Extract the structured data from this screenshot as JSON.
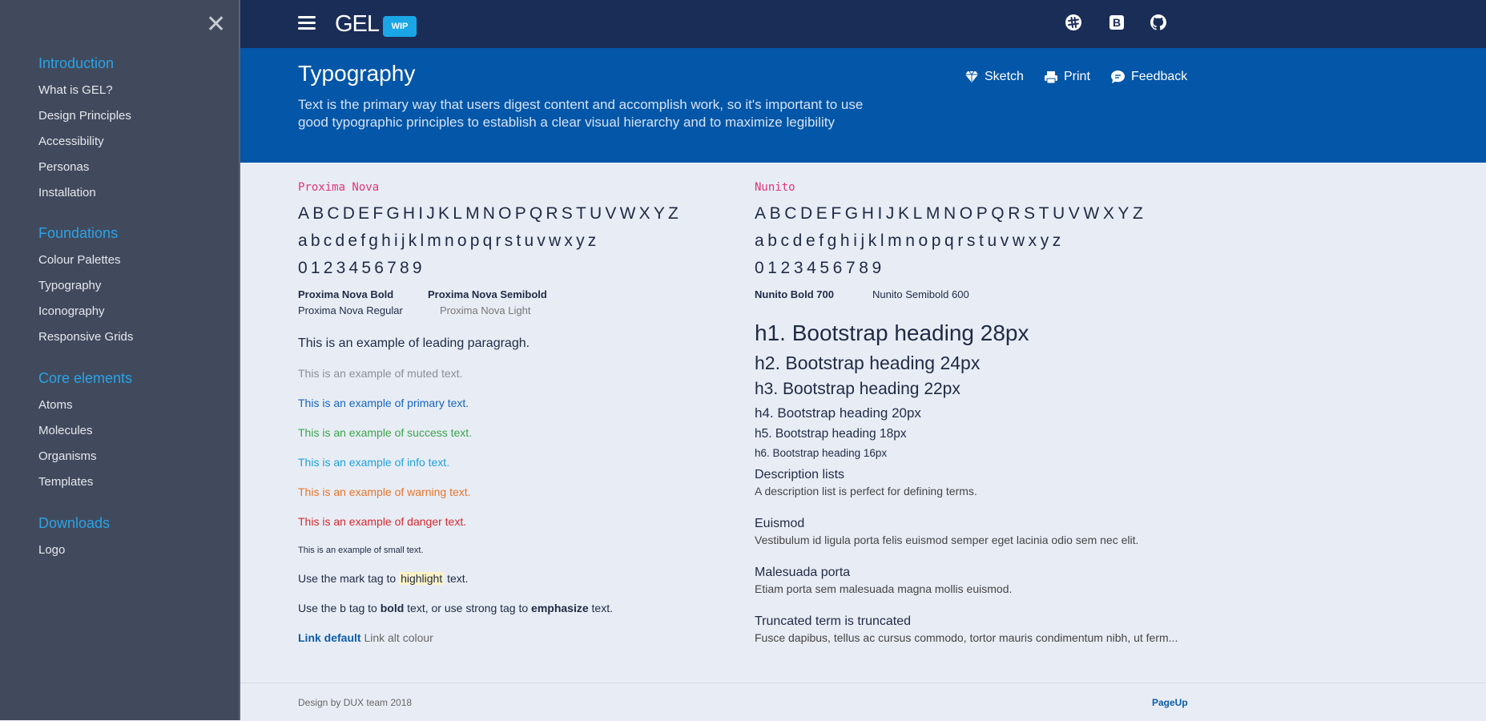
{
  "sidebar": {
    "close_glyph": "✕",
    "sections": [
      {
        "title": "Introduction",
        "items": [
          "What is GEL?",
          "Design Principles",
          "Accessibility",
          "Personas",
          "Installation"
        ]
      },
      {
        "title": "Foundations",
        "items": [
          "Colour Palettes",
          "Typography",
          "Iconography",
          "Responsive Grids"
        ]
      },
      {
        "title": "Core elements",
        "items": [
          "Atoms",
          "Molecules",
          "Organisms",
          "Templates"
        ]
      },
      {
        "title": "Downloads",
        "items": [
          "Logo"
        ]
      }
    ]
  },
  "topbar": {
    "logo": "GEL",
    "badge": "WIP",
    "icons": [
      "slack-icon",
      "bootstrap-icon",
      "github-icon"
    ],
    "bootstrap_letter": "B"
  },
  "header": {
    "title": "Typography",
    "lead": "Text is the primary way that users digest content and accomplish work, so it's important to use good typographic principles to establish a clear visual hierarchy and to maximize legibility",
    "actions": [
      {
        "label": "Sketch",
        "icon": "diamond-icon"
      },
      {
        "label": "Print",
        "icon": "printer-icon"
      },
      {
        "label": "Feedback",
        "icon": "speech-bubble-icon"
      }
    ]
  },
  "left": {
    "font_name": "Proxima Nova",
    "upper": "ABCDEFGHIJKLMNOPQRSTUVWXYZ",
    "lower": "abcdefghijklmnopqrstuvwxyz",
    "digits": "0123456789",
    "weights": {
      "bold": "Proxima Nova Bold",
      "semibold": "Proxima Nova Semibold",
      "regular": "Proxima Nova Regular",
      "light": "Proxima Nova Light"
    },
    "lead_text": "This is an example of leading paragragh.",
    "muted": "This is an example of muted text.",
    "primary": "This is an example of primary text.",
    "success": "This is an example of success text.",
    "info": "This is an example of info text.",
    "warning": "This is an example of warning text.",
    "danger": "This is an example of danger text.",
    "small": "This is an example of small text.",
    "mark_before": "Use the mark tag to ",
    "mark_word": "highlight",
    "mark_after": " text.",
    "b_before": "Use the b tag to ",
    "b_word": "bold",
    "b_mid": " text, or use strong tag to ",
    "strong_word": "emphasize",
    "b_after": " text.",
    "link_default": "Link default",
    "link_alt": "Link alt colour"
  },
  "right": {
    "font_name": "Nunito",
    "upper": "ABCDEFGHIJKLMNOPQRSTUVWXYZ",
    "lower": "abcdefghijklmnopqrstuvwxyz",
    "digits": "0123456789",
    "weights": {
      "bold": "Nunito Bold 700",
      "semibold": "Nunito Semibold 600"
    },
    "headings": [
      "h1. Bootstrap heading 28px",
      "h2. Bootstrap heading 24px",
      "h3. Bootstrap heading 22px",
      "h4. Bootstrap heading 20px",
      "h5. Bootstrap heading 18px",
      "h6. Bootstrap heading 16px"
    ],
    "dl": [
      {
        "term": "Description lists",
        "desc": "A description list is perfect for defining terms."
      },
      {
        "term": "Euismod",
        "desc": "Vestibulum id ligula porta felis euismod semper eget lacinia odio sem nec elit."
      },
      {
        "term": "Malesuada porta",
        "desc": "Etiam porta sem malesuada magna mollis euismod."
      },
      {
        "term": "Truncated term is truncated",
        "desc": "Fusce dapibus, tellus ac cursus commodo, tortor mauris condimentum nibh, ut ferm..."
      }
    ]
  },
  "footer": {
    "credit": "Design by DUX team 2018",
    "pageup": "PageUp"
  },
  "colors": {
    "sidebar_bg": "#414a5c",
    "accent": "#2aa3e8",
    "topbar_bg": "#1a2d57",
    "header_bg": "#0356a8",
    "primary_text": "#1565c0",
    "success_text": "#3aa64a",
    "info_text": "#1ea1dc",
    "warning_text": "#e8742a",
    "danger_text": "#d9272e",
    "font_name_pink": "#e0357a"
  }
}
